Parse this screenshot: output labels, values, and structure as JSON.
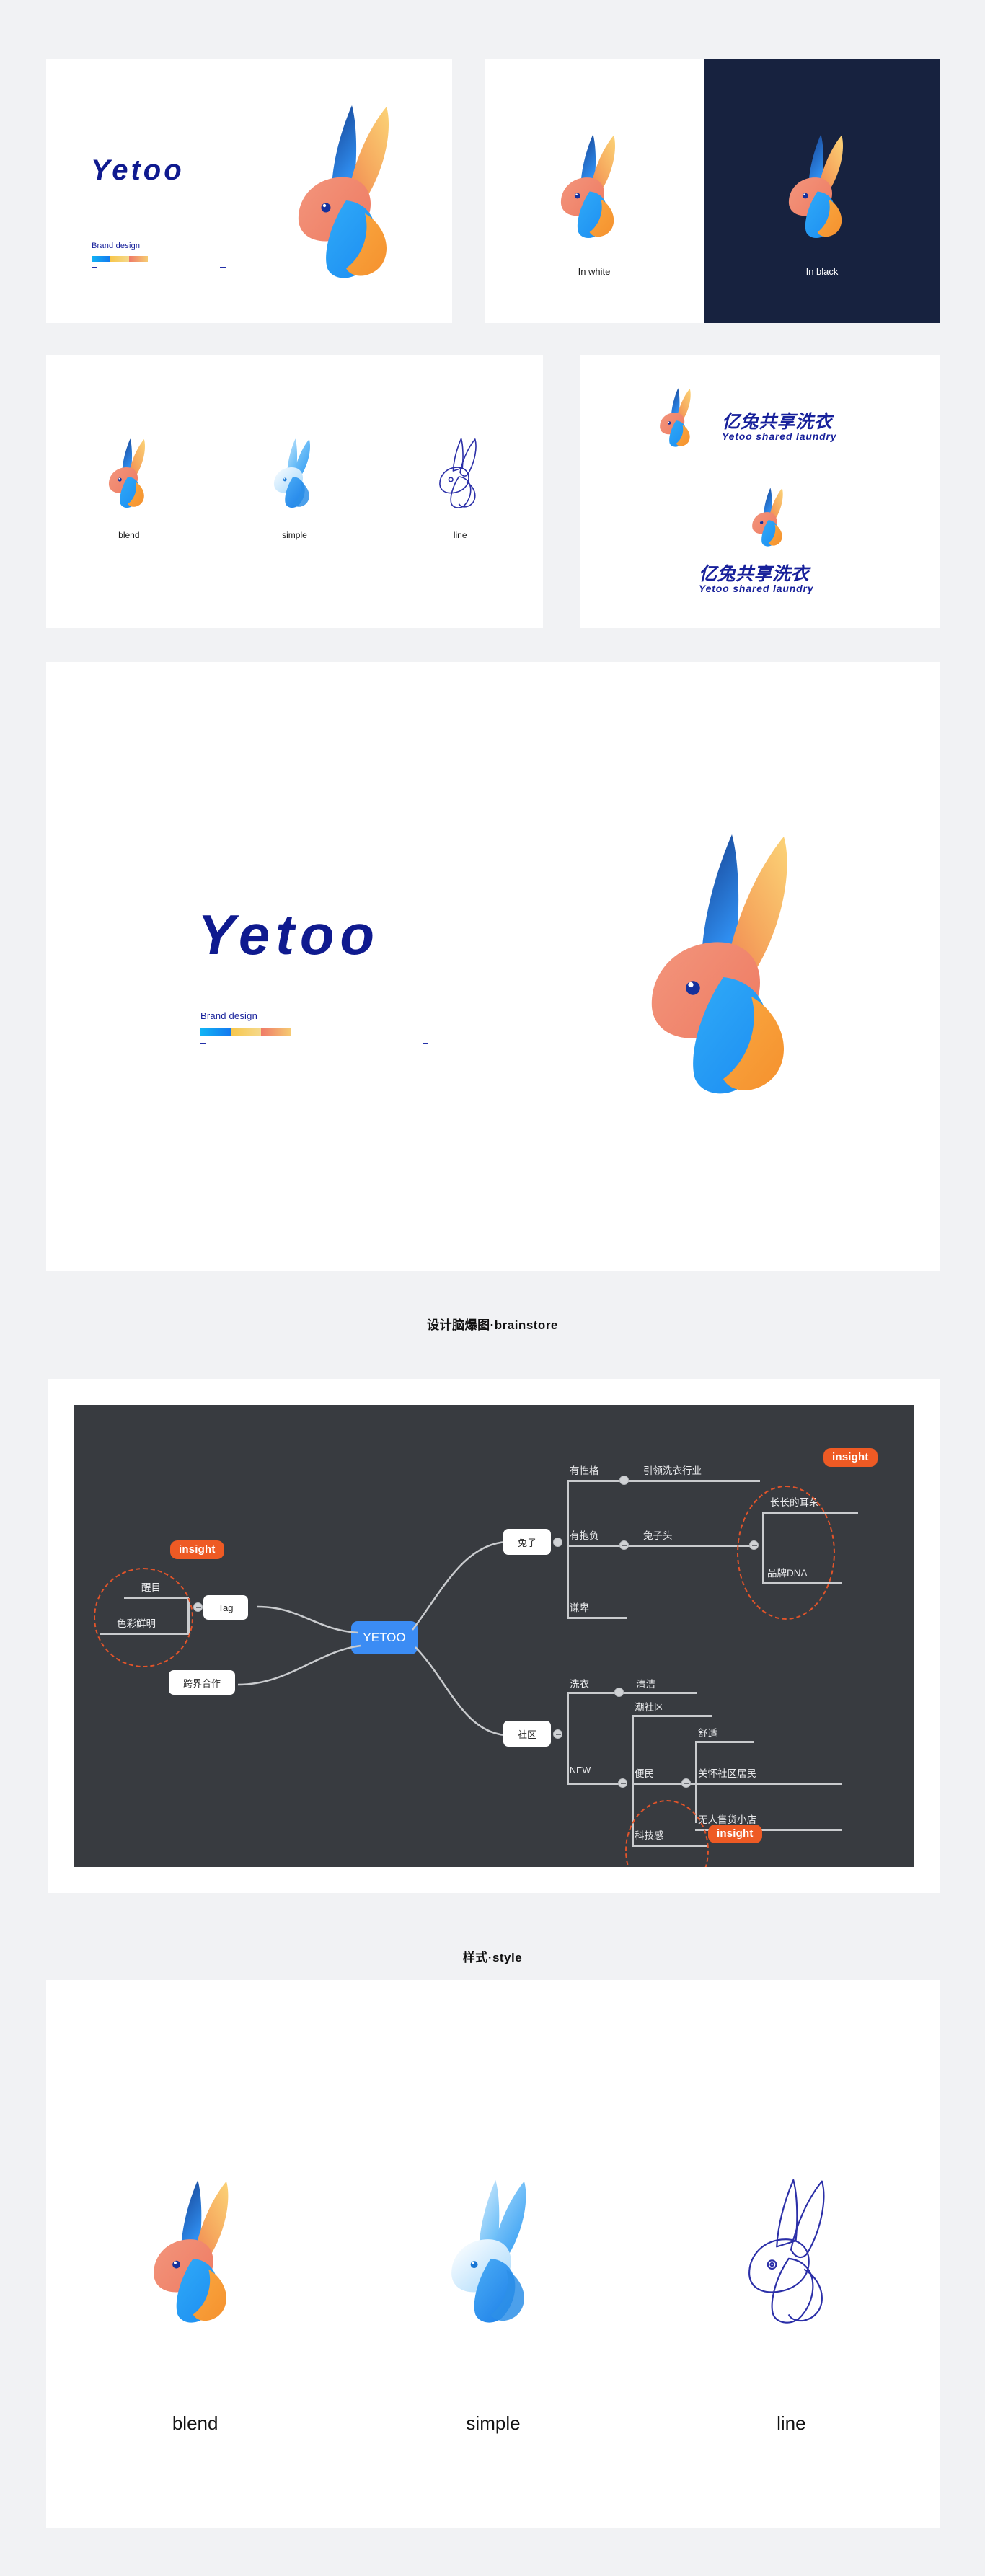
{
  "page": {
    "background_color": "#f1f2f4",
    "card_background": "#ffffff"
  },
  "brand": {
    "wordmark": "Yetoo",
    "wordmark_color": "#0f1a8f",
    "brand_design_label": "Brand design",
    "palette": [
      {
        "name": "cyan-blue",
        "from": "#11b4f5",
        "to": "#1479ef"
      },
      {
        "name": "yellow-gold",
        "from": "#f7c64b",
        "to": "#f5d98c"
      },
      {
        "name": "salmon-gold",
        "from": "#ef7a68",
        "to": "#f6cc72"
      }
    ]
  },
  "row1": {
    "hero_card": {
      "wordmark": "Yetoo",
      "brand_design_label": "Brand design"
    },
    "in_white": {
      "caption": "In white",
      "background": "#ffffff"
    },
    "in_black": {
      "caption": "In black",
      "background": "#17223f"
    }
  },
  "row2": {
    "styles": [
      {
        "caption": "blend"
      },
      {
        "caption": "simple"
      },
      {
        "caption": "line"
      }
    ],
    "lockups": [
      {
        "cn": "亿兔共享洗衣",
        "en": "Yetoo  shared  laundry",
        "orientation": "horizontal"
      },
      {
        "cn": "亿兔共享洗衣",
        "en": "Yetoo  shared  laundry",
        "orientation": "vertical"
      }
    ]
  },
  "hero_big": {
    "wordmark": "Yetoo",
    "brand_design_label": "Brand design"
  },
  "sections": [
    {
      "id": "brainstore",
      "title": "设计脑爆图·brainstore"
    },
    {
      "id": "style",
      "title": "样式·style"
    }
  ],
  "mindmap": {
    "board_color": "#383b40",
    "root": "YETOO",
    "insight_label": "insight",
    "insight_color": "#ee5a24",
    "branches": {
      "tag": {
        "node": "Tag",
        "children": [
          "醒目",
          "色彩鲜明"
        ]
      },
      "cross": {
        "node": "跨界合作"
      },
      "rabbit": {
        "node": "兔子",
        "children": [
          "有性格",
          "有抱负",
          "谦卑"
        ],
        "level3": [
          "引领洗衣行业",
          "兔子头"
        ],
        "level4": [
          "长长的耳朵",
          "品牌DNA"
        ]
      },
      "community": {
        "node": "社区",
        "children": [
          "洗衣",
          "NEW"
        ],
        "level3": [
          "清洁",
          "潮社区",
          "便民",
          "科技感"
        ],
        "level4": [
          "舒适",
          "关怀社区居民",
          "无人售货小店"
        ]
      }
    }
  },
  "styles_big": [
    {
      "caption": "blend"
    },
    {
      "caption": "simple"
    },
    {
      "caption": "line"
    }
  ]
}
